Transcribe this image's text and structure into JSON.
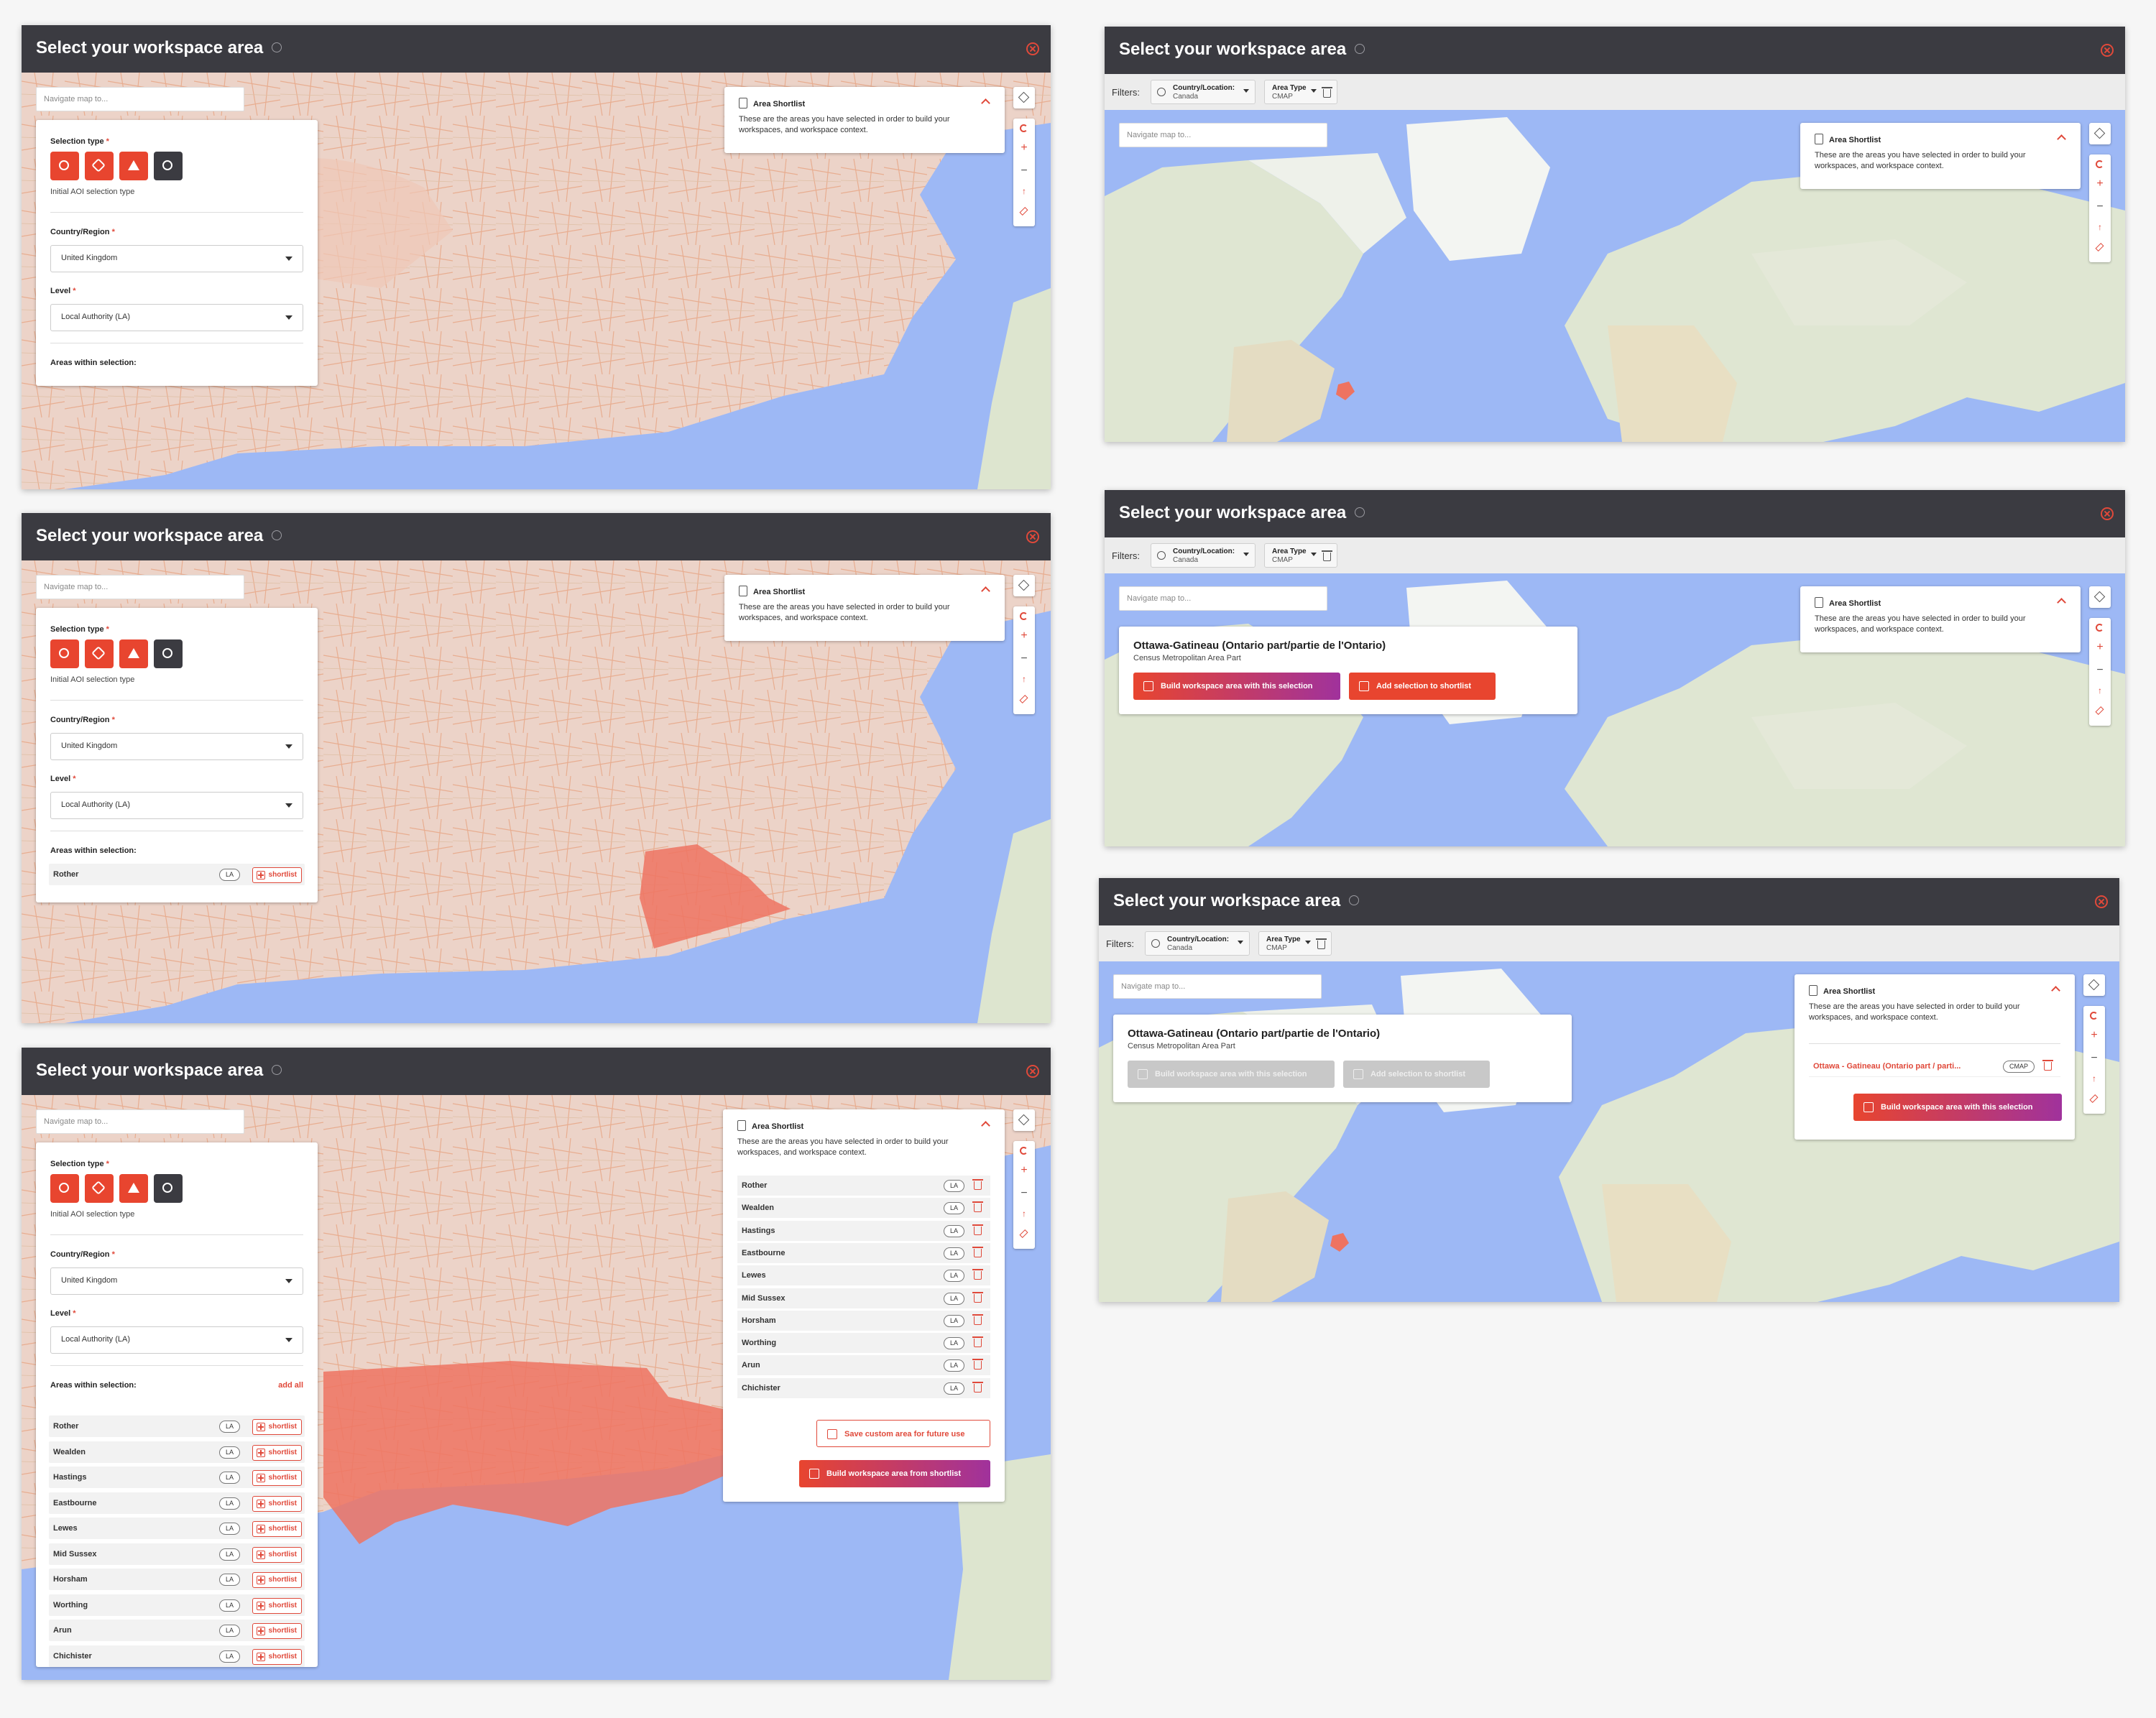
{
  "window_title": "Select your workspace area",
  "search_placeholder": "Navigate map to...",
  "left_panel": {
    "selection_type_label": "Selection type",
    "selection_hint": "Initial AOI selection type",
    "country_label": "Country/Region",
    "country_value": "United Kingdom",
    "level_label": "Level",
    "level_value": "Local Authority (LA)",
    "areas_label": "Areas within selection:",
    "add_all": "add all",
    "la_badge": "LA",
    "shortlist_btn": "shortlist"
  },
  "shortlist_panel": {
    "title": "Area Shortlist",
    "desc": "These are the areas you have selected in order to build your workspaces, and workspace context.",
    "save_btn": "Save custom area for future use",
    "build_btn": "Build workspace area from shortlist",
    "build_selection_btn": "Build workspace area with this selection"
  },
  "areas": [
    "Rother",
    "Wealden",
    "Hastings",
    "Eastbourne",
    "Lewes",
    "Mid Sussex",
    "Horsham",
    "Worthing",
    "Arun",
    "Chichister"
  ],
  "first_area": "Rother",
  "filters": {
    "label": "Filters:",
    "country_key": "Country/Location:",
    "country_val": "Canada",
    "type_key": "Area Type",
    "type_val": "CMAP"
  },
  "selection_popup": {
    "title": "Ottawa-Gatineau (Ontario part/partie de l'Ontario)",
    "subtitle": "Census Metropolitan Area Part",
    "build_btn": "Build workspace area with this selection",
    "add_btn": "Add selection to shortlist"
  },
  "shortlisted_item": {
    "name": "Ottawa - Gatineau (Ontario part / parti...",
    "badge": "CMAP"
  },
  "colors": {
    "titlebar": "#3b3b41",
    "accent_red": "#e8452f",
    "accent_purple": "#a0329c",
    "sea": "#9db8f5",
    "land_uk": "#ecd3c8",
    "highlight": "#ee7361"
  }
}
